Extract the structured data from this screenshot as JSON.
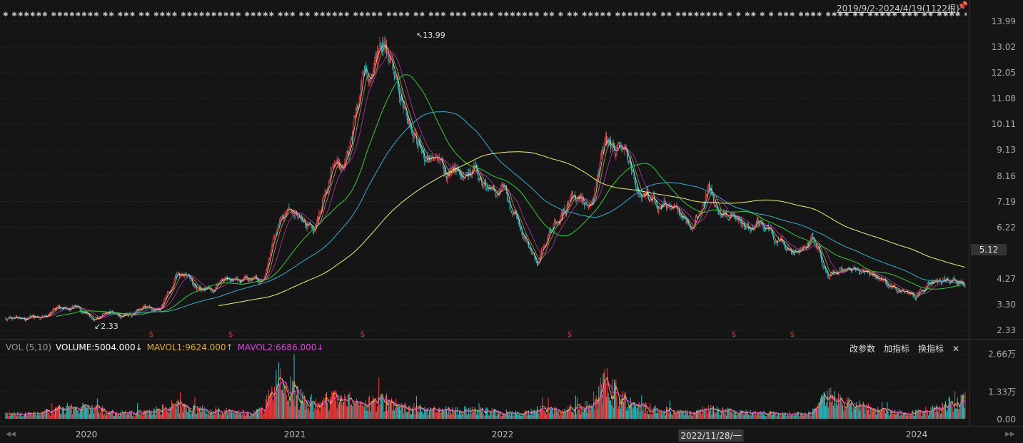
{
  "header": {
    "range_label": "2019/9/2-2024/4/19(1122根)",
    "pin_icon": "pin-icon"
  },
  "chart_data": {
    "type": "candlestick",
    "bars": 1122,
    "start": "2019/9/2",
    "end": "2024/4/19",
    "price_axis": {
      "ticks": [
        "13.99",
        "13.02",
        "12.05",
        "11.08",
        "10.11",
        "9.13",
        "8.16",
        "7.19",
        "6.22",
        "4.27",
        "3.30",
        "2.33"
      ],
      "min": 2.33,
      "max": 13.99,
      "current": "5.12"
    },
    "annotations": {
      "high": "13.99",
      "low": "2.33"
    },
    "monthly_close": [
      2.8,
      2.75,
      2.9,
      3.0,
      3.2,
      2.6,
      2.9,
      2.95,
      3.0,
      3.1,
      4.4,
      4.0,
      3.9,
      4.2,
      4.0,
      4.0,
      6.5,
      6.5,
      5.9,
      8.8,
      8.7,
      12.5,
      13.5,
      11.0,
      9.8,
      8.8,
      8.4,
      8.5,
      7.5,
      7.3,
      6.0,
      4.8,
      6.5,
      7.5,
      7.2,
      10.0,
      9.0,
      7.4,
      7.0,
      6.9,
      6.2,
      7.7,
      6.8,
      6.5,
      6.3,
      5.8,
      5.2,
      5.8,
      4.6,
      4.8,
      4.7,
      4.4,
      4.0,
      3.6,
      4.2,
      4.25,
      4.2
    ],
    "monthly_volume": [
      2000,
      1800,
      2200,
      3500,
      4500,
      4000,
      2500,
      2200,
      2500,
      3500,
      5500,
      4000,
      3000,
      3000,
      2500,
      3500,
      16000,
      9000,
      6000,
      8000,
      7000,
      6000,
      6500,
      5000,
      4000,
      3500,
      3500,
      3500,
      3000,
      2500,
      2200,
      3500,
      3000,
      4000,
      5000,
      14000,
      8000,
      5000,
      3500,
      3000,
      2500,
      4000,
      3000,
      2500,
      2200,
      2000,
      2000,
      2500,
      9000,
      6000,
      4500,
      3000,
      2500,
      2500,
      3500,
      6000,
      9000
    ],
    "x_ticks": [
      "2020",
      "2021",
      "2022",
      "2022/11/28/一",
      "2024"
    ],
    "ma_periods": [
      5,
      10,
      20,
      60,
      120,
      250
    ],
    "colors": {
      "up": "#ff3b3b",
      "down": "#26c6c6",
      "ma5": "#ffffff",
      "ma10": "#e8c040",
      "ma20": "#e040e0",
      "ma60": "#30d030",
      "ma120": "#30b0d0",
      "ma250": "#f0f070"
    }
  },
  "volume": {
    "title": "VOL (5,10)",
    "volume": "VOLUME:5004.000↓",
    "mavol1": "MAVOL1:9624.000↑",
    "mavol2": "MAVOL2:6686.000↓",
    "axis": [
      "2.66万",
      "1.33万",
      "0.00"
    ],
    "max": 26600,
    "tools": [
      "改参数",
      "加指标",
      "换指标",
      "✕"
    ]
  },
  "event_marker": "$"
}
